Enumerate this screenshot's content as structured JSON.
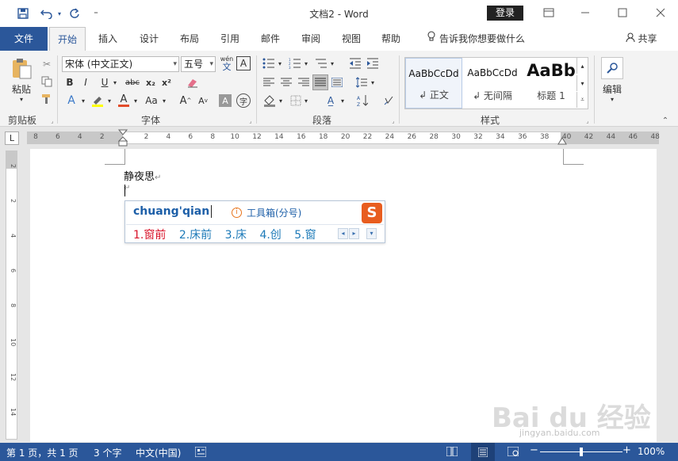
{
  "titlebar": {
    "title": "文档2  -  Word",
    "login": "登录",
    "qat_customize": "₹"
  },
  "tabs": {
    "file": "文件",
    "items": [
      "开始",
      "插入",
      "设计",
      "布局",
      "引用",
      "邮件",
      "审阅",
      "视图",
      "帮助"
    ],
    "tellme": "告诉我你想要做什么",
    "share": "共享"
  },
  "ribbon": {
    "clipboard": {
      "label": "剪贴板",
      "paste": "粘贴"
    },
    "font": {
      "label": "字体",
      "font_name": "宋体 (中文正文)",
      "font_size": "五号",
      "wen": "wén",
      "wen_char": "文",
      "bold": "B",
      "italic": "I",
      "underline": "U",
      "strike": "abc",
      "sub": "x₂",
      "sup": "x²",
      "case": "Aa",
      "grow": "A",
      "shrink": "A",
      "char_shade": "A",
      "enclose": "字"
    },
    "paragraph": {
      "label": "段落"
    },
    "styles": {
      "label": "样式",
      "items": [
        {
          "preview": "AaBbCcDd",
          "name": "↲ 正文"
        },
        {
          "preview": "AaBbCcDd",
          "name": "↲ 无间隔"
        },
        {
          "preview": "AaBb",
          "name": "标题 1"
        }
      ]
    },
    "editing": {
      "label": "编辑"
    }
  },
  "ruler": {
    "labels": [
      "8",
      "6",
      "4",
      "2",
      "",
      "2",
      "4",
      "6",
      "8",
      "10",
      "12",
      "14",
      "16",
      "18",
      "20",
      "22",
      "24",
      "26",
      "28",
      "30",
      "32",
      "34",
      "36",
      "38",
      "40",
      "42",
      "44",
      "46",
      "48"
    ],
    "vlabels": [
      "2",
      "2",
      "4",
      "6",
      "8",
      "10",
      "12",
      "14"
    ],
    "corner": "L"
  },
  "document": {
    "line1": "静夜思",
    "pilcrow": "↵"
  },
  "ime": {
    "pinyin": "chuang'qian",
    "tool_text": "工具箱(分号)",
    "tool_icon": "i",
    "logo": "S",
    "candidates": [
      "1.窗前",
      "2.床前",
      "3.床",
      "4.创",
      "5.窗"
    ]
  },
  "status": {
    "page": "第 1 页，共 1 页",
    "words": "3 个字",
    "lang": "中文(中国)",
    "zoom": "100%",
    "zoom_level": 1.0
  },
  "watermark": {
    "text": "Bai du 经验",
    "sub": "jingyan.baidu.com"
  }
}
